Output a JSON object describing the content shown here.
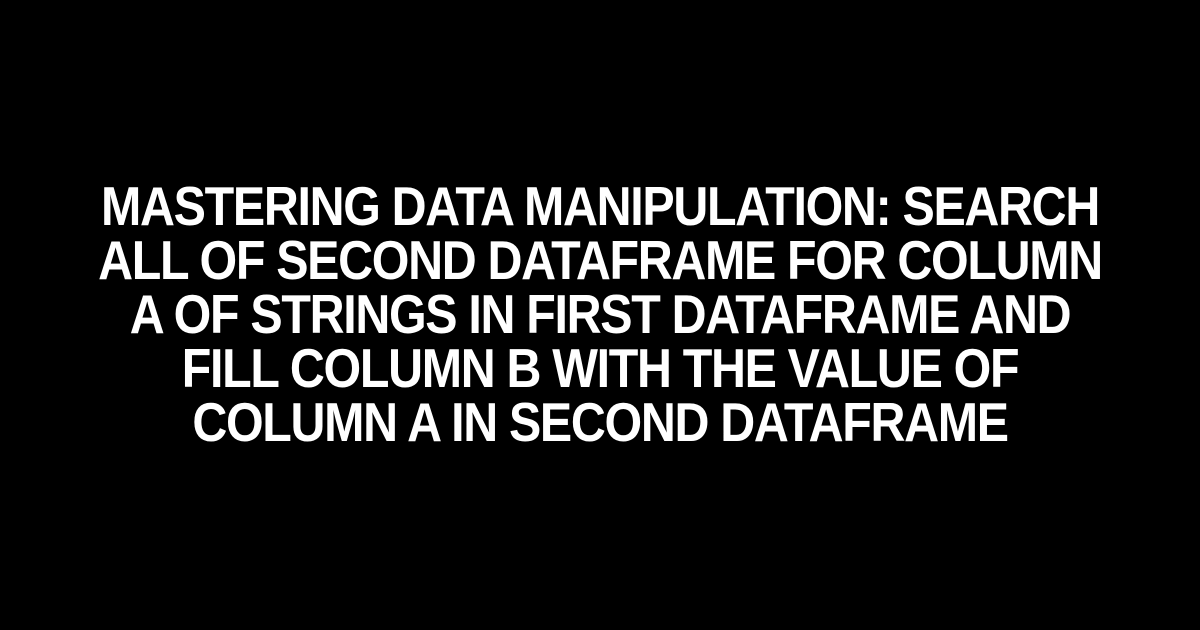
{
  "headline": "Mastering Data Manipulation: Search All of Second Dataframe for Column A of Strings in First Dataframe and Fill Column B with the Value of Column A in Second Dataframe"
}
